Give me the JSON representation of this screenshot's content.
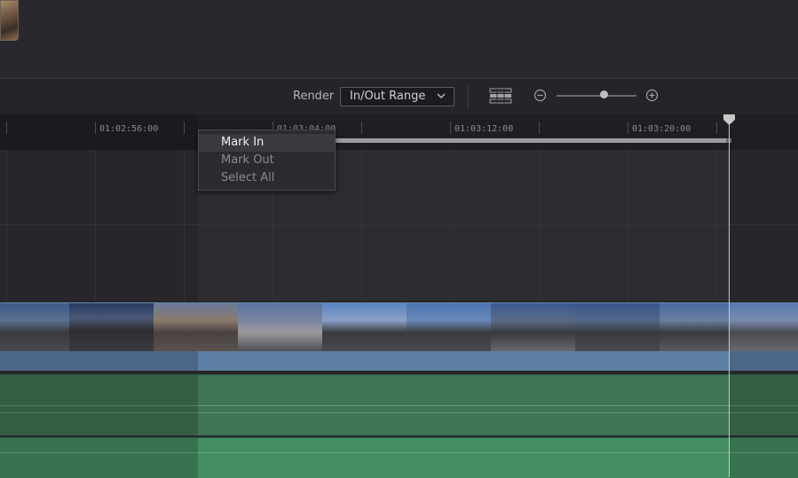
{
  "toolbar": {
    "render_label": "Render",
    "render_value": "In/Out Range",
    "icons": [
      "grid-view-icon",
      "zoom-out-icon",
      "zoom-in-icon"
    ]
  },
  "ruler": {
    "timecodes": [
      "01:02:56:00",
      "01:03:04:00",
      "01:03:12:00",
      "01:03:20:00"
    ]
  },
  "context_menu": {
    "items": [
      {
        "label": "Mark In",
        "state": "active"
      },
      {
        "label": "Mark Out",
        "state": "disabled"
      },
      {
        "label": "Select All",
        "state": "disabled"
      }
    ]
  },
  "colors": {
    "video_track": "#5d7fa3",
    "audio_track": "#3e7353",
    "audio_track_2": "#448d60",
    "background": "#28282e"
  }
}
